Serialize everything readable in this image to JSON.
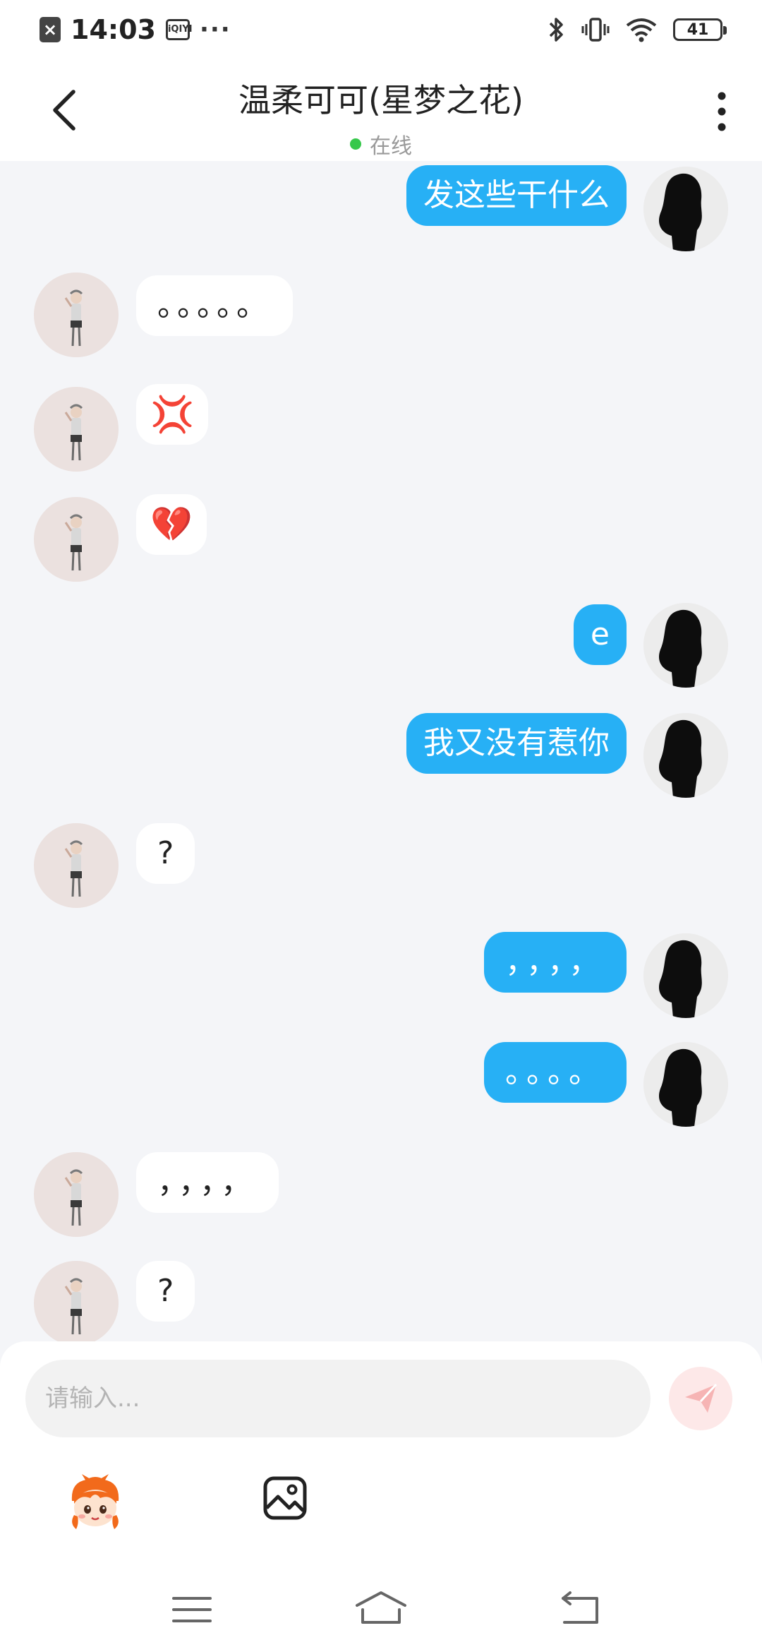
{
  "status_bar": {
    "time": "14:03",
    "iqiyi_label": "iQIYI",
    "more_dots": "···",
    "battery": "41"
  },
  "header": {
    "title": "温柔可可(星梦之花)",
    "status": "在线"
  },
  "messages": [
    {
      "side": "self",
      "text": "发这些干什么"
    },
    {
      "side": "other",
      "text": "。。。。。"
    },
    {
      "side": "other",
      "text": "💢"
    },
    {
      "side": "other",
      "text": "💔"
    },
    {
      "side": "self",
      "text": "e"
    },
    {
      "side": "self",
      "text": "我又没有惹你"
    },
    {
      "side": "other",
      "text": "?"
    },
    {
      "side": "self",
      "text": "，，，，"
    },
    {
      "side": "self",
      "text": "。。。。"
    },
    {
      "side": "other",
      "text": "，，，，"
    },
    {
      "side": "other",
      "text": "?"
    }
  ],
  "input": {
    "placeholder": "请输入..."
  },
  "colors": {
    "self_bubble": "#27b0f5",
    "online_dot": "#36c84b"
  }
}
